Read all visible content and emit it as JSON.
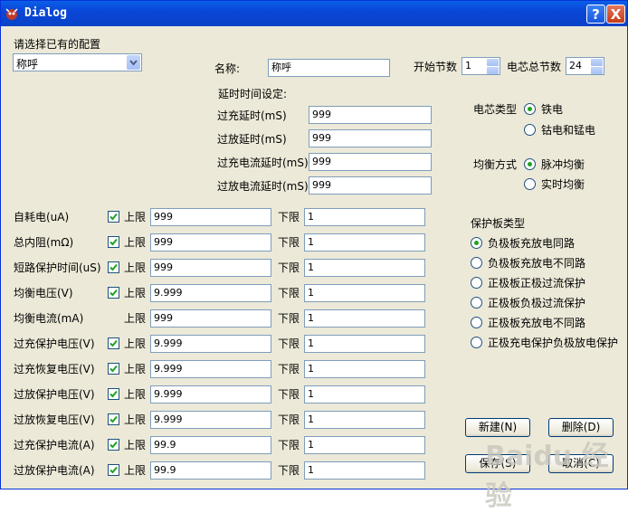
{
  "window": {
    "title": "Dialog",
    "help_label": "?",
    "close_label": "X"
  },
  "config": {
    "label": "请选择已有的配置",
    "selected": "称呼"
  },
  "name": {
    "label": "名称:",
    "value": "称呼"
  },
  "start_section": {
    "label": "开始节数",
    "value": "1"
  },
  "total_cells": {
    "label": "电芯总节数",
    "value": "24"
  },
  "delay": {
    "heading": "延时时间设定:",
    "rows": [
      {
        "label": "过充延时(mS)",
        "value": "999"
      },
      {
        "label": "过放延时(mS)",
        "value": "999"
      },
      {
        "label": "过充电流延时(mS)",
        "value": "999"
      },
      {
        "label": "过放电流延时(mS)",
        "value": "999"
      }
    ]
  },
  "cell_type": {
    "label": "电芯类型",
    "options": [
      "铁电",
      "钴电和锰电"
    ],
    "selected": 0
  },
  "balance_mode": {
    "label": "均衡方式",
    "options": [
      "脉冲均衡",
      "实时均衡"
    ],
    "selected": 0
  },
  "board_type": {
    "label": "保护板类型",
    "options": [
      "负极板充放电同路",
      "负极板充放电不同路",
      "正极板正极过流保护",
      "正极板负极过流保护",
      "正极板充放电不同路",
      "正极充电保护负极放电保护"
    ],
    "selected": 0
  },
  "limits": {
    "upper_label": "上限",
    "lower_label": "下限",
    "rows": [
      {
        "label": "自耗电(uA)",
        "checked": true,
        "upper": "999",
        "lower": "1"
      },
      {
        "label": "总内阻(mΩ)",
        "checked": true,
        "upper": "999",
        "lower": "1"
      },
      {
        "label": "短路保护时间(uS)",
        "checked": true,
        "upper": "999",
        "lower": "1"
      },
      {
        "label": "均衡电压(V)",
        "checked": true,
        "upper": "9.999",
        "lower": "1"
      },
      {
        "label": "均衡电流(mA)",
        "checked": false,
        "upper": "999",
        "lower": "1"
      },
      {
        "label": "过充保护电压(V)",
        "checked": true,
        "upper": "9.999",
        "lower": "1"
      },
      {
        "label": "过充恢复电压(V)",
        "checked": true,
        "upper": "9.999",
        "lower": "1"
      },
      {
        "label": "过放保护电压(V)",
        "checked": true,
        "upper": "9.999",
        "lower": "1"
      },
      {
        "label": "过放恢复电压(V)",
        "checked": true,
        "upper": "9.999",
        "lower": "1"
      },
      {
        "label": "过充保护电流(A)",
        "checked": true,
        "upper": "99.9",
        "lower": "1"
      },
      {
        "label": "过放保护电流(A)",
        "checked": true,
        "upper": "99.9",
        "lower": "1"
      }
    ]
  },
  "buttons": {
    "new": "新建(N)",
    "delete": "删除(D)",
    "save": "保存(S)",
    "cancel": "取消(C)"
  },
  "watermark": "Baidu 经验"
}
